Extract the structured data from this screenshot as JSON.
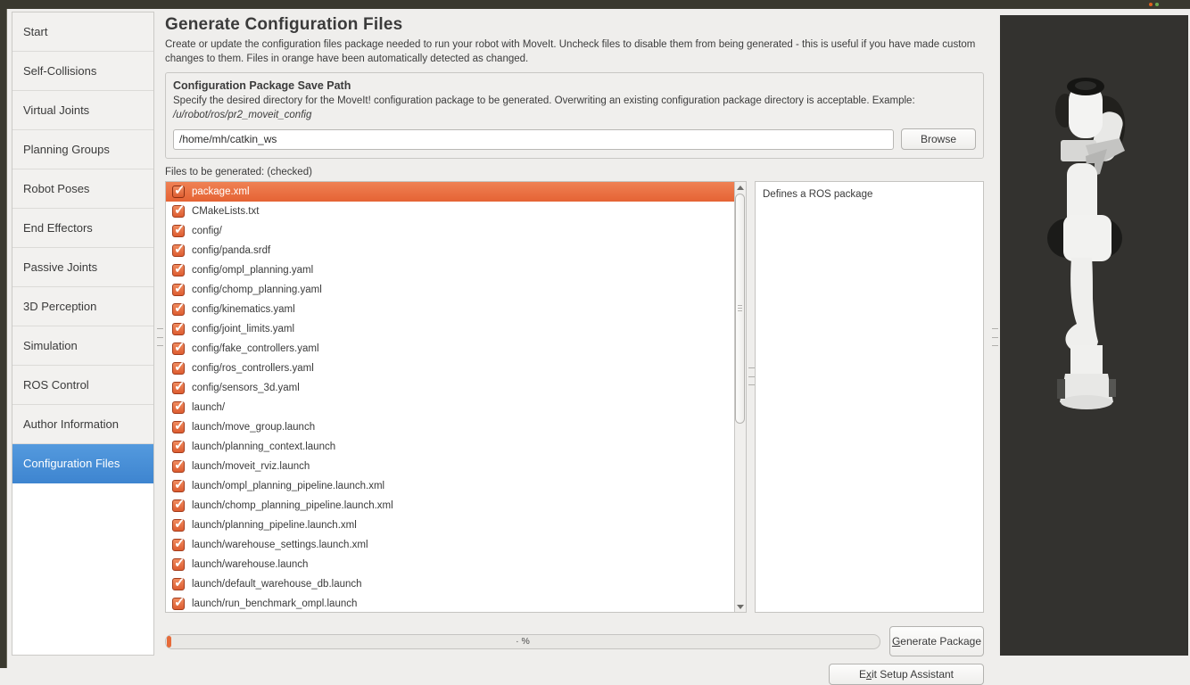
{
  "sidebar": {
    "items": [
      "Start",
      "Self-Collisions",
      "Virtual Joints",
      "Planning Groups",
      "Robot Poses",
      "End Effectors",
      "Passive Joints",
      "3D Perception",
      "Simulation",
      "ROS Control",
      "Author Information",
      "Configuration Files"
    ],
    "selected": "Configuration Files"
  },
  "main": {
    "title": "Generate Configuration Files",
    "description": "Create or update the configuration files package needed to run your robot with MoveIt. Uncheck files to disable them from being generated - this is useful if you have made custom changes to them. Files in orange have been automatically detected as changed.",
    "save_path_group": {
      "title": "Configuration Package Save Path",
      "description": "Specify the desired directory for the MoveIt! configuration package to be generated. Overwriting an existing configuration package directory is acceptable. Example:",
      "example_path": "/u/robot/ros/pr2_moveit_config",
      "path_value": "/home/mh/catkin_ws",
      "browse_label": "Browse"
    },
    "files_label": "Files to be generated: (checked)",
    "file_list": [
      "package.xml",
      "CMakeLists.txt",
      "config/",
      "config/panda.srdf",
      "config/ompl_planning.yaml",
      "config/chomp_planning.yaml",
      "config/kinematics.yaml",
      "config/joint_limits.yaml",
      "config/fake_controllers.yaml",
      "config/ros_controllers.yaml",
      "config/sensors_3d.yaml",
      "launch/",
      "launch/move_group.launch",
      "launch/planning_context.launch",
      "launch/moveit_rviz.launch",
      "launch/ompl_planning_pipeline.launch.xml",
      "launch/chomp_planning_pipeline.launch.xml",
      "launch/planning_pipeline.launch.xml",
      "launch/warehouse_settings.launch.xml",
      "launch/warehouse.launch",
      "launch/default_warehouse_db.launch",
      "launch/run_benchmark_ompl.launch"
    ],
    "selected_file": "package.xml",
    "file_info": "Defines a ROS package",
    "progress": {
      "text": "· %"
    },
    "generate_button": {
      "pre": "",
      "mnemonic": "G",
      "post": "enerate Package"
    },
    "exit_button": {
      "pre": "E",
      "mnemonic": "x",
      "post": "it Setup Assistant"
    }
  },
  "icons": {
    "checkbox_checked": "✓ orange checked box",
    "scroll_up": "triangle-up",
    "scroll_down": "triangle-down"
  },
  "colors": {
    "accent_orange": "#e56334",
    "selection_blue": "#4a90d9",
    "render_background": "#33322f",
    "chrome_strip": "#3a392f"
  }
}
